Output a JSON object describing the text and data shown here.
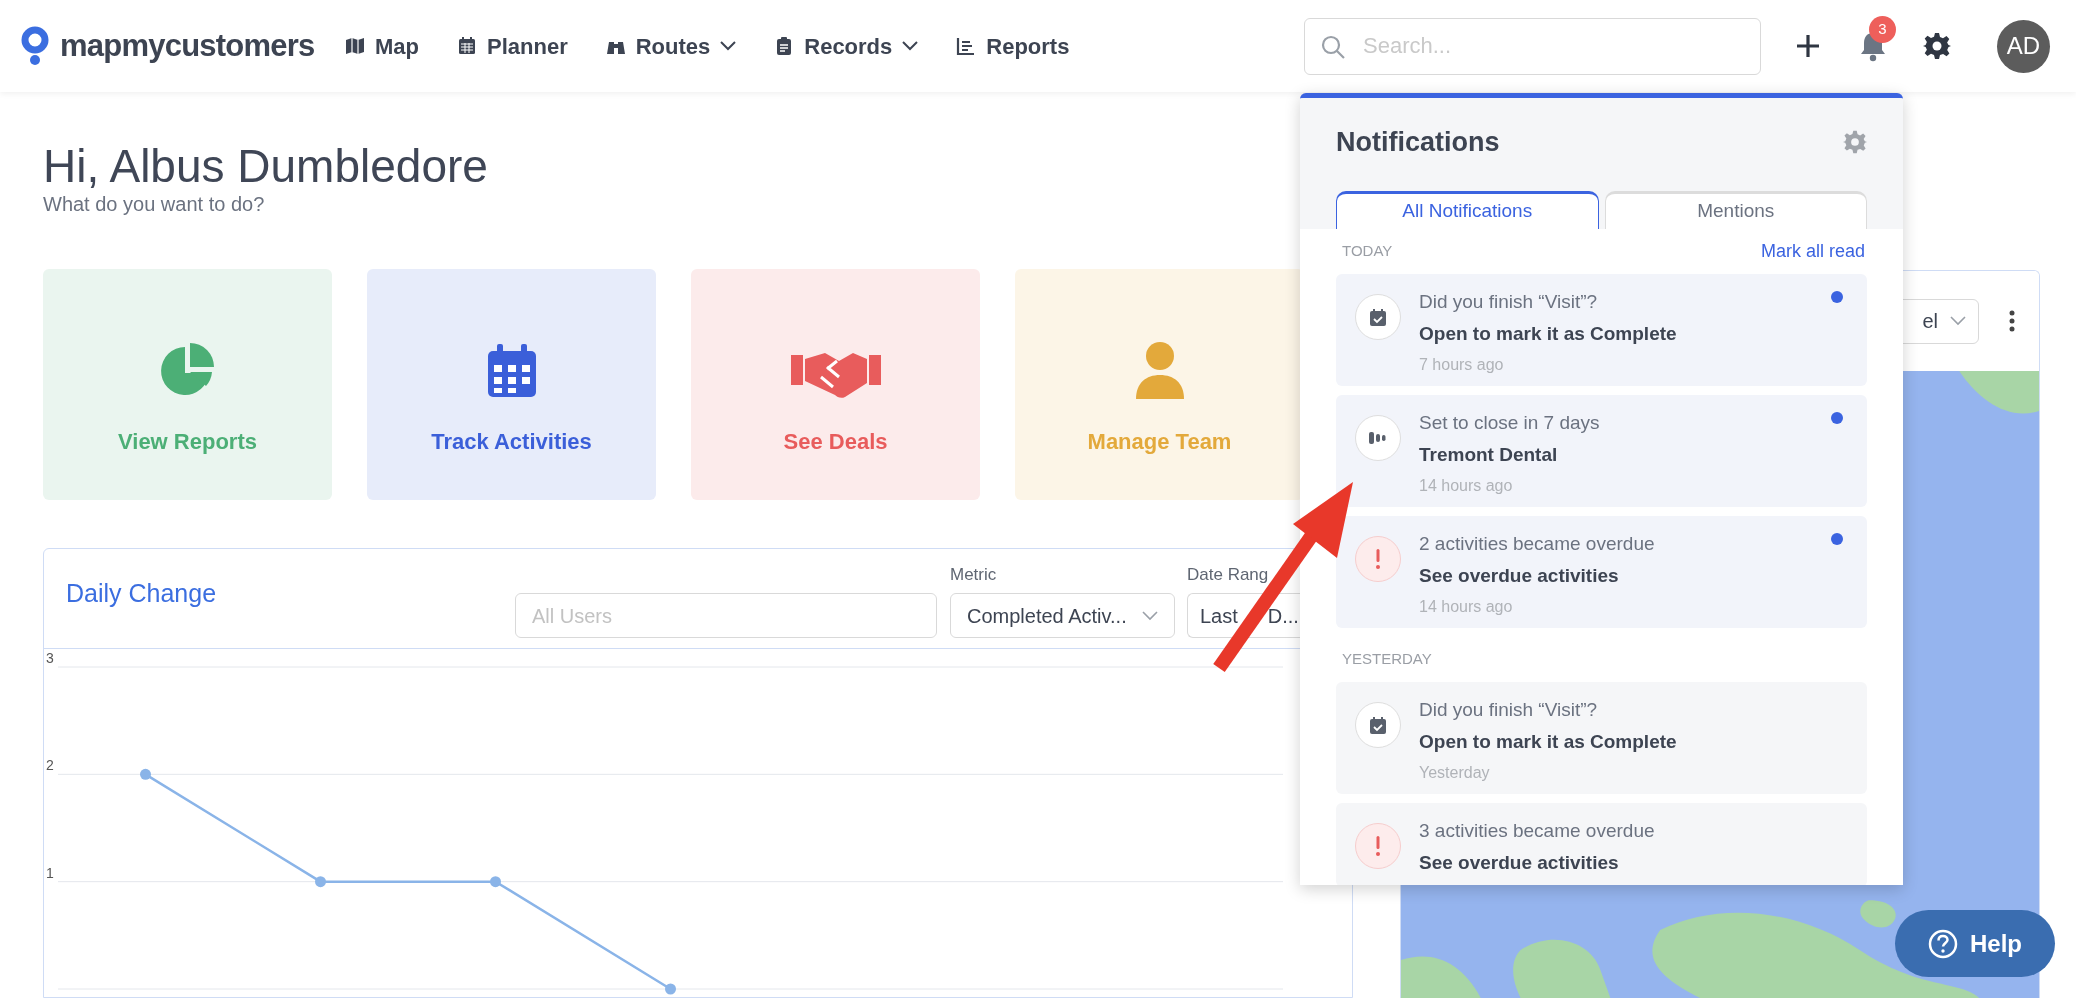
{
  "nav": {
    "logo": "mapmycustomers",
    "items": [
      {
        "label": "Map",
        "dropdown": false
      },
      {
        "label": "Planner",
        "dropdown": false
      },
      {
        "label": "Routes",
        "dropdown": true
      },
      {
        "label": "Records",
        "dropdown": true
      },
      {
        "label": "Reports",
        "dropdown": false
      }
    ]
  },
  "search": {
    "placeholder": "Search..."
  },
  "notification_count": "3",
  "avatar": "AD",
  "greeting": {
    "title": "Hi, Albus Dumbledore",
    "subtitle": "What do you want to do?"
  },
  "quick_actions": [
    {
      "label": "View Reports",
      "kind": "pie",
      "color": "#4caf76"
    },
    {
      "label": "Track Activities",
      "kind": "calendar",
      "color": "#3b5fd9"
    },
    {
      "label": "See Deals",
      "kind": "handshake",
      "color": "#e85c5c"
    },
    {
      "label": "Manage Team",
      "kind": "person",
      "color": "#e3a93b"
    }
  ],
  "daily_change": {
    "title": "Daily Change",
    "user_filter": {
      "placeholder": "All Users"
    },
    "metric": {
      "label": "Metric",
      "value": "Completed Activ..."
    },
    "date_range": {
      "label": "Date Rang",
      "value_start": "Last",
      "value_end": "D..."
    },
    "chart_data": {
      "type": "line",
      "categories": [
        null,
        null,
        null,
        null,
        null,
        null,
        null
      ],
      "ylim": [
        0,
        3
      ],
      "yticks": [
        1,
        2,
        3
      ],
      "series": [
        {
          "color": "#8ab4e8",
          "marker": "circle",
          "values": [
            2,
            1,
            1,
            0,
            null,
            null,
            null
          ]
        }
      ]
    }
  },
  "map_card": {
    "dropdown_value": "el"
  },
  "notifications": {
    "title": "Notifications",
    "tabs": [
      {
        "label": "All Notifications",
        "selected": true
      },
      {
        "label": "Mentions",
        "selected": false
      }
    ],
    "mark_all": "Mark all read",
    "groups": [
      {
        "heading": "TODAY",
        "items": [
          {
            "kind": "activity",
            "title": "Did you finish “Visit”?",
            "subtitle": "Open to mark it as Complete",
            "time": "7 hours ago",
            "unread": true
          },
          {
            "kind": "deal",
            "title": "Set to close in 7 days",
            "subtitle": "Tremont Dental",
            "time": "14 hours ago",
            "unread": true
          },
          {
            "kind": "overdue",
            "title": "2 activities became overdue",
            "subtitle": "See overdue activities",
            "time": "14 hours ago",
            "unread": true
          }
        ]
      },
      {
        "heading": "YESTERDAY",
        "items": [
          {
            "kind": "activity",
            "title": "Did you finish “Visit”?",
            "subtitle": "Open to mark it as Complete",
            "time": "Yesterday",
            "unread": false
          },
          {
            "kind": "overdue",
            "title": "3 activities became overdue",
            "subtitle": "See overdue activities",
            "unread": false
          }
        ]
      }
    ]
  },
  "help": "Help"
}
